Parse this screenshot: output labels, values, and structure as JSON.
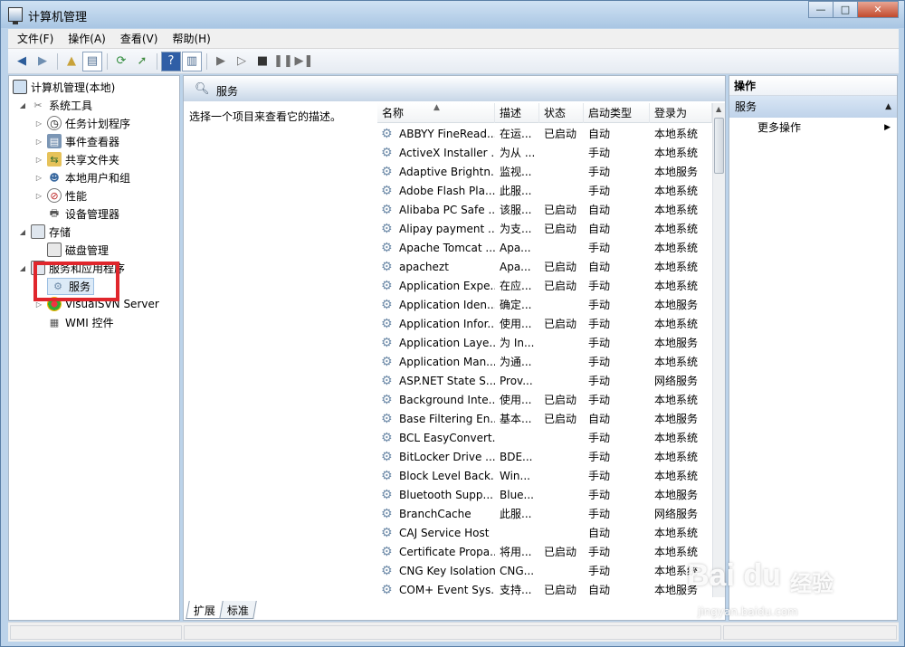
{
  "window": {
    "title": "计算机管理",
    "minimize": "—",
    "maximize": "□",
    "close": "✕"
  },
  "menu": [
    "文件(F)",
    "操作(A)",
    "查看(V)",
    "帮助(H)"
  ],
  "tree": {
    "root": "计算机管理(本地)",
    "system_tools": "系统工具",
    "task_scheduler": "任务计划程序",
    "event_viewer": "事件查看器",
    "shared_folders": "共享文件夹",
    "local_users": "本地用户和组",
    "performance": "性能",
    "device_manager": "设备管理器",
    "storage": "存储",
    "disk_management": "磁盘管理",
    "services_apps": "服务和应用程序",
    "services": "服务",
    "visualsvn": "VisualSVN Server",
    "wmi": "WMI 控件"
  },
  "middle": {
    "title": "服务",
    "description": "选择一个项目来查看它的描述。",
    "columns": [
      "名称",
      "描述",
      "状态",
      "启动类型",
      "登录为"
    ],
    "rows": [
      [
        "ABBYY FineRead...",
        "在运...",
        "已启动",
        "自动",
        "本地系统"
      ],
      [
        "ActiveX Installer ...",
        "为从 ...",
        "",
        "手动",
        "本地系统"
      ],
      [
        "Adaptive Brightn...",
        "监视...",
        "",
        "手动",
        "本地服务"
      ],
      [
        "Adobe Flash Pla...",
        "此服...",
        "",
        "手动",
        "本地系统"
      ],
      [
        "Alibaba PC Safe ...",
        "该服...",
        "已启动",
        "自动",
        "本地系统"
      ],
      [
        "Alipay payment ...",
        "为支...",
        "已启动",
        "自动",
        "本地系统"
      ],
      [
        "Apache Tomcat ...",
        "Apa...",
        "",
        "手动",
        "本地系统"
      ],
      [
        "apachezt",
        "Apa...",
        "已启动",
        "自动",
        "本地系统"
      ],
      [
        "Application Expe...",
        "在应...",
        "已启动",
        "手动",
        "本地系统"
      ],
      [
        "Application Iden...",
        "确定...",
        "",
        "手动",
        "本地服务"
      ],
      [
        "Application Infor...",
        "使用...",
        "已启动",
        "手动",
        "本地系统"
      ],
      [
        "Application Laye...",
        "为 In...",
        "",
        "手动",
        "本地服务"
      ],
      [
        "Application Man...",
        "为通...",
        "",
        "手动",
        "本地系统"
      ],
      [
        "ASP.NET State S...",
        "Prov...",
        "",
        "手动",
        "网络服务"
      ],
      [
        "Background Inte...",
        "使用...",
        "已启动",
        "手动",
        "本地系统"
      ],
      [
        "Base Filtering En...",
        "基本...",
        "已启动",
        "自动",
        "本地服务"
      ],
      [
        "BCL EasyConvert...",
        "",
        "",
        "手动",
        "本地系统"
      ],
      [
        "BitLocker Drive ...",
        "BDE...",
        "",
        "手动",
        "本地系统"
      ],
      [
        "Block Level Back...",
        "Win...",
        "",
        "手动",
        "本地系统"
      ],
      [
        "Bluetooth Supp...",
        "Blue...",
        "",
        "手动",
        "本地服务"
      ],
      [
        "BranchCache",
        "此服...",
        "",
        "手动",
        "网络服务"
      ],
      [
        "CAJ Service Host",
        "",
        "",
        "自动",
        "本地系统"
      ],
      [
        "Certificate Propa...",
        "将用...",
        "已启动",
        "手动",
        "本地系统"
      ],
      [
        "CNG Key Isolation",
        "CNG...",
        "",
        "手动",
        "本地系统"
      ],
      [
        "COM+ Event Sys...",
        "支持...",
        "已启动",
        "自动",
        "本地服务"
      ]
    ],
    "tabs": [
      "扩展",
      "标准"
    ]
  },
  "actions": {
    "header": "操作",
    "section": "服务",
    "more": "更多操作"
  },
  "watermark": {
    "logo": "Bai du",
    "cn": "经验",
    "url": "jingyan.baidu.com"
  }
}
